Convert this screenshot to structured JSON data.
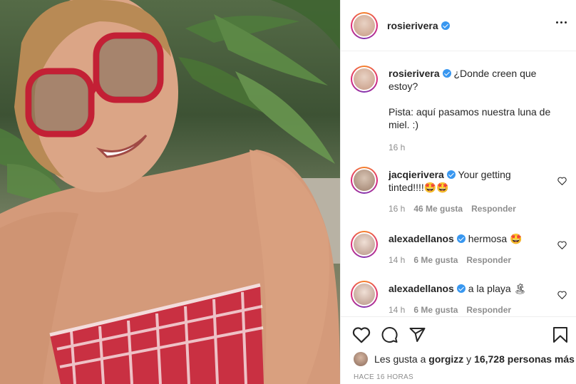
{
  "post": {
    "username": "rosierivera",
    "photo_alt": ""
  },
  "comments": [
    {
      "username": "rosierivera",
      "text": "¿Donde creen que estoy?",
      "text2": "Pista: aquí pasamos nuestra luna de miel. :)",
      "time": "16 h"
    },
    {
      "username": "jacqierivera",
      "text": "Your getting tinted!!!!🤩🤩",
      "time": "16 h",
      "likes": "46 Me gusta",
      "reply": "Responder"
    },
    {
      "username": "alexadellanos",
      "text": "hermosa 🤩",
      "time": "14 h",
      "likes": "6 Me gusta",
      "reply": "Responder"
    },
    {
      "username": "alexadellanos",
      "text": "a la playa 🏝",
      "time": "14 h",
      "likes": "6 Me gusta",
      "reply": "Responder"
    }
  ],
  "likes": {
    "prefix": "Les gusta a",
    "user": "gorgizz",
    "conj": "y",
    "count": "16,728 personas más"
  },
  "timestamp": "HACE 16 HORAS",
  "colors": {
    "verified": "#3897f0",
    "muted": "#8e8e8e",
    "text": "#262626"
  }
}
